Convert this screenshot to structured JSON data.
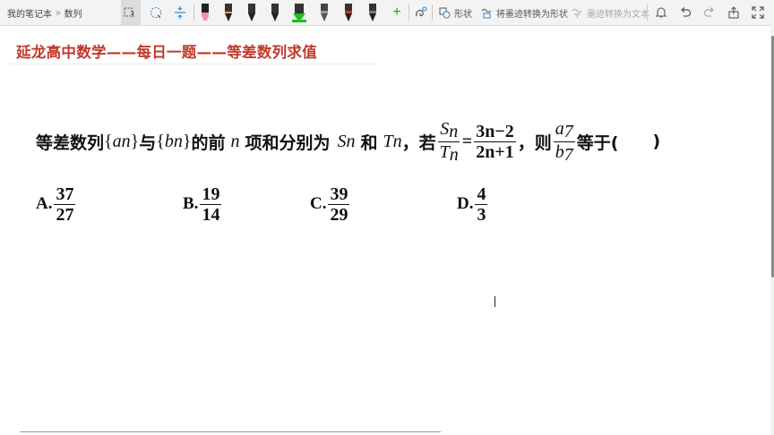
{
  "toolbar": {
    "breadcrumb": {
      "notebook": "我的笔记本",
      "separator": "»",
      "section": "数列"
    },
    "tools": [
      "lasso-select-icon",
      "add-space-icon",
      "insert-space-icon"
    ],
    "pens": [
      {
        "icon": "highlighter-pink-icon",
        "color": "#f48fb1"
      },
      {
        "icon": "pen-black-icon",
        "color": "#222222"
      },
      {
        "icon": "pen-black-icon",
        "color": "#222222"
      },
      {
        "icon": "pen-black-icon",
        "color": "#222222"
      },
      {
        "icon": "highlighter-green-icon",
        "color": "#19c21f"
      },
      {
        "icon": "pen-gray-icon",
        "color": "#555555"
      },
      {
        "icon": "pen-red-icon",
        "color": "#d32f2f"
      },
      {
        "icon": "pen-dark-icon",
        "color": "#333333"
      }
    ],
    "add_pen": "+",
    "shapes_label": "形状",
    "ink_to_shape_label": "将墨迹转换为形状",
    "ink_to_text_label": "墨迹转换为文本"
  },
  "page": {
    "title": "延龙高中数学——每日一题——等差数列求值",
    "question": {
      "text1": "等差数列",
      "a_brace_open": "{",
      "a_var": "a",
      "a_sub": "n",
      "a_brace_close": "}",
      "text2": "与",
      "b_brace_open": "{",
      "b_var": "b",
      "b_sub": "n",
      "b_brace_close": "}",
      "text3": "的前",
      "n_var": "n",
      "text4": "项和分别为",
      "S_var": "S",
      "S_sub": "n",
      "text5": "和",
      "T_var": "T",
      "T_sub": "n",
      "text6": "，若",
      "ratio_num_var": "S",
      "ratio_num_sub": "n",
      "ratio_den_var": "T",
      "ratio_den_sub": "n",
      "equals": "=",
      "expr_num": "3n−2",
      "expr_den": "2n+1",
      "text7": "，则",
      "target_num_var": "a",
      "target_num_sub": "7",
      "target_den_var": "b",
      "target_den_sub": "7",
      "text8": "等于(",
      "blank": "　　",
      "text9": ")"
    },
    "options": [
      {
        "label": "A.",
        "num": "37",
        "den": "27"
      },
      {
        "label": "B.",
        "num": "19",
        "den": "14"
      },
      {
        "label": "C.",
        "num": "39",
        "den": "29"
      },
      {
        "label": "D.",
        "num": "4",
        "den": "3"
      }
    ]
  }
}
